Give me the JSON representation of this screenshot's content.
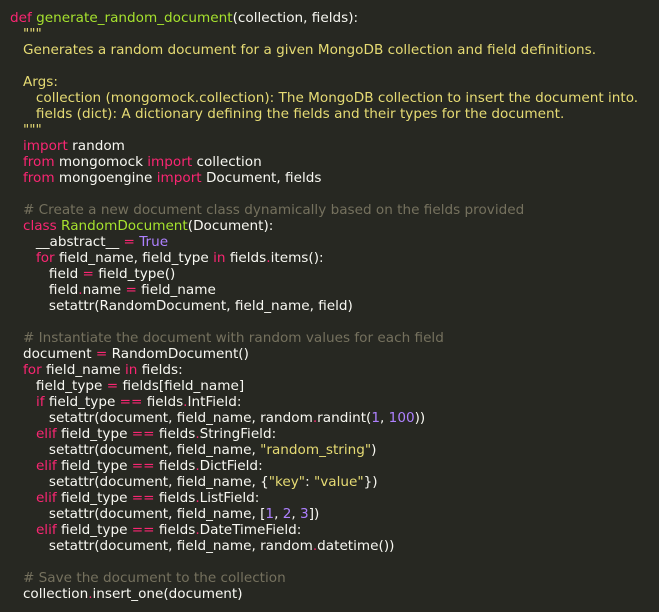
{
  "colors": {
    "background": "#272822",
    "plain": "#f8f8f2",
    "keyword": "#f92672",
    "function_name": "#a6e22e",
    "string": "#e6db74",
    "number": "#ae81ff",
    "comment": "#75715e"
  },
  "code": {
    "lines": [
      [
        {
          "t": "def",
          "c": "kw"
        },
        {
          "t": " ",
          "c": "pl"
        },
        {
          "t": "generate_random_document",
          "c": "fn"
        },
        {
          "t": "(collection, fields):",
          "c": "pl"
        }
      ],
      [
        {
          "t": "   \"\"\"",
          "c": "str"
        }
      ],
      [
        {
          "t": "   Generates a random document for a given MongoDB collection and field definitions.",
          "c": "str"
        }
      ],
      [
        {
          "t": "",
          "c": "pl"
        }
      ],
      [
        {
          "t": "   Args:",
          "c": "str"
        }
      ],
      [
        {
          "t": "      collection (mongomock.collection): The MongoDB collection to insert the document into.",
          "c": "str"
        }
      ],
      [
        {
          "t": "      fields (dict): A dictionary defining the fields and their types for the document.",
          "c": "str"
        }
      ],
      [
        {
          "t": "   \"\"\"",
          "c": "str"
        }
      ],
      [
        {
          "t": "   ",
          "c": "pl"
        },
        {
          "t": "import",
          "c": "kw"
        },
        {
          "t": " random",
          "c": "pl"
        }
      ],
      [
        {
          "t": "   ",
          "c": "pl"
        },
        {
          "t": "from",
          "c": "kw"
        },
        {
          "t": " mongomock ",
          "c": "pl"
        },
        {
          "t": "import",
          "c": "kw"
        },
        {
          "t": " collection",
          "c": "pl"
        }
      ],
      [
        {
          "t": "   ",
          "c": "pl"
        },
        {
          "t": "from",
          "c": "kw"
        },
        {
          "t": " mongoengine ",
          "c": "pl"
        },
        {
          "t": "import",
          "c": "kw"
        },
        {
          "t": " Document, fields",
          "c": "pl"
        }
      ],
      [
        {
          "t": "",
          "c": "pl"
        }
      ],
      [
        {
          "t": "   # Create a new document class dynamically based on the fields provided",
          "c": "cmt"
        }
      ],
      [
        {
          "t": "   ",
          "c": "pl"
        },
        {
          "t": "class",
          "c": "kw"
        },
        {
          "t": " ",
          "c": "pl"
        },
        {
          "t": "RandomDocument",
          "c": "cls"
        },
        {
          "t": "(Document):",
          "c": "pl"
        }
      ],
      [
        {
          "t": "      __abstract__ ",
          "c": "pl"
        },
        {
          "t": "=",
          "c": "op"
        },
        {
          "t": " ",
          "c": "pl"
        },
        {
          "t": "True",
          "c": "const"
        }
      ],
      [
        {
          "t": "      ",
          "c": "pl"
        },
        {
          "t": "for",
          "c": "kw"
        },
        {
          "t": " field_name, field_type ",
          "c": "pl"
        },
        {
          "t": "in",
          "c": "kw"
        },
        {
          "t": " fields",
          "c": "pl"
        },
        {
          "t": ".",
          "c": "op"
        },
        {
          "t": "items():",
          "c": "pl"
        }
      ],
      [
        {
          "t": "         field ",
          "c": "pl"
        },
        {
          "t": "=",
          "c": "op"
        },
        {
          "t": " field_type()",
          "c": "pl"
        }
      ],
      [
        {
          "t": "         field",
          "c": "pl"
        },
        {
          "t": ".",
          "c": "op"
        },
        {
          "t": "name ",
          "c": "pl"
        },
        {
          "t": "=",
          "c": "op"
        },
        {
          "t": " field_name",
          "c": "pl"
        }
      ],
      [
        {
          "t": "         setattr(RandomDocument, field_name, field)",
          "c": "pl"
        }
      ],
      [
        {
          "t": "",
          "c": "pl"
        }
      ],
      [
        {
          "t": "   # Instantiate the document with random values for each field",
          "c": "cmt"
        }
      ],
      [
        {
          "t": "   document ",
          "c": "pl"
        },
        {
          "t": "=",
          "c": "op"
        },
        {
          "t": " RandomDocument()",
          "c": "pl"
        }
      ],
      [
        {
          "t": "   ",
          "c": "pl"
        },
        {
          "t": "for",
          "c": "kw"
        },
        {
          "t": " field_name ",
          "c": "pl"
        },
        {
          "t": "in",
          "c": "kw"
        },
        {
          "t": " fields:",
          "c": "pl"
        }
      ],
      [
        {
          "t": "      field_type ",
          "c": "pl"
        },
        {
          "t": "=",
          "c": "op"
        },
        {
          "t": " fields[field_name]",
          "c": "pl"
        }
      ],
      [
        {
          "t": "      ",
          "c": "pl"
        },
        {
          "t": "if",
          "c": "kw"
        },
        {
          "t": " field_type ",
          "c": "pl"
        },
        {
          "t": "==",
          "c": "op"
        },
        {
          "t": " fields",
          "c": "pl"
        },
        {
          "t": ".",
          "c": "op"
        },
        {
          "t": "IntField:",
          "c": "pl"
        }
      ],
      [
        {
          "t": "         setattr(document, field_name, random",
          "c": "pl"
        },
        {
          "t": ".",
          "c": "op"
        },
        {
          "t": "randint(",
          "c": "pl"
        },
        {
          "t": "1",
          "c": "num"
        },
        {
          "t": ", ",
          "c": "pl"
        },
        {
          "t": "100",
          "c": "num"
        },
        {
          "t": "))",
          "c": "pl"
        }
      ],
      [
        {
          "t": "      ",
          "c": "pl"
        },
        {
          "t": "elif",
          "c": "kw"
        },
        {
          "t": " field_type ",
          "c": "pl"
        },
        {
          "t": "==",
          "c": "op"
        },
        {
          "t": " fields",
          "c": "pl"
        },
        {
          "t": ".",
          "c": "op"
        },
        {
          "t": "StringField:",
          "c": "pl"
        }
      ],
      [
        {
          "t": "         setattr(document, field_name, ",
          "c": "pl"
        },
        {
          "t": "\"random_string\"",
          "c": "str"
        },
        {
          "t": ")",
          "c": "pl"
        }
      ],
      [
        {
          "t": "      ",
          "c": "pl"
        },
        {
          "t": "elif",
          "c": "kw"
        },
        {
          "t": " field_type ",
          "c": "pl"
        },
        {
          "t": "==",
          "c": "op"
        },
        {
          "t": " fields",
          "c": "pl"
        },
        {
          "t": ".",
          "c": "op"
        },
        {
          "t": "DictField:",
          "c": "pl"
        }
      ],
      [
        {
          "t": "         setattr(document, field_name, {",
          "c": "pl"
        },
        {
          "t": "\"key\"",
          "c": "str"
        },
        {
          "t": ": ",
          "c": "pl"
        },
        {
          "t": "\"value\"",
          "c": "str"
        },
        {
          "t": "})",
          "c": "pl"
        }
      ],
      [
        {
          "t": "      ",
          "c": "pl"
        },
        {
          "t": "elif",
          "c": "kw"
        },
        {
          "t": " field_type ",
          "c": "pl"
        },
        {
          "t": "==",
          "c": "op"
        },
        {
          "t": " fields",
          "c": "pl"
        },
        {
          "t": ".",
          "c": "op"
        },
        {
          "t": "ListField:",
          "c": "pl"
        }
      ],
      [
        {
          "t": "         setattr(document, field_name, [",
          "c": "pl"
        },
        {
          "t": "1",
          "c": "num"
        },
        {
          "t": ", ",
          "c": "pl"
        },
        {
          "t": "2",
          "c": "num"
        },
        {
          "t": ", ",
          "c": "pl"
        },
        {
          "t": "3",
          "c": "num"
        },
        {
          "t": "])",
          "c": "pl"
        }
      ],
      [
        {
          "t": "      ",
          "c": "pl"
        },
        {
          "t": "elif",
          "c": "kw"
        },
        {
          "t": " field_type ",
          "c": "pl"
        },
        {
          "t": "==",
          "c": "op"
        },
        {
          "t": " fields",
          "c": "pl"
        },
        {
          "t": ".",
          "c": "op"
        },
        {
          "t": "DateTimeField:",
          "c": "pl"
        }
      ],
      [
        {
          "t": "         setattr(document, field_name, random",
          "c": "pl"
        },
        {
          "t": ".",
          "c": "op"
        },
        {
          "t": "datetime())",
          "c": "pl"
        }
      ],
      [
        {
          "t": "",
          "c": "pl"
        }
      ],
      [
        {
          "t": "   # Save the document to the collection",
          "c": "cmt"
        }
      ],
      [
        {
          "t": "   collection",
          "c": "pl"
        },
        {
          "t": ".",
          "c": "op"
        },
        {
          "t": "insert_one(document)",
          "c": "pl"
        }
      ]
    ]
  }
}
